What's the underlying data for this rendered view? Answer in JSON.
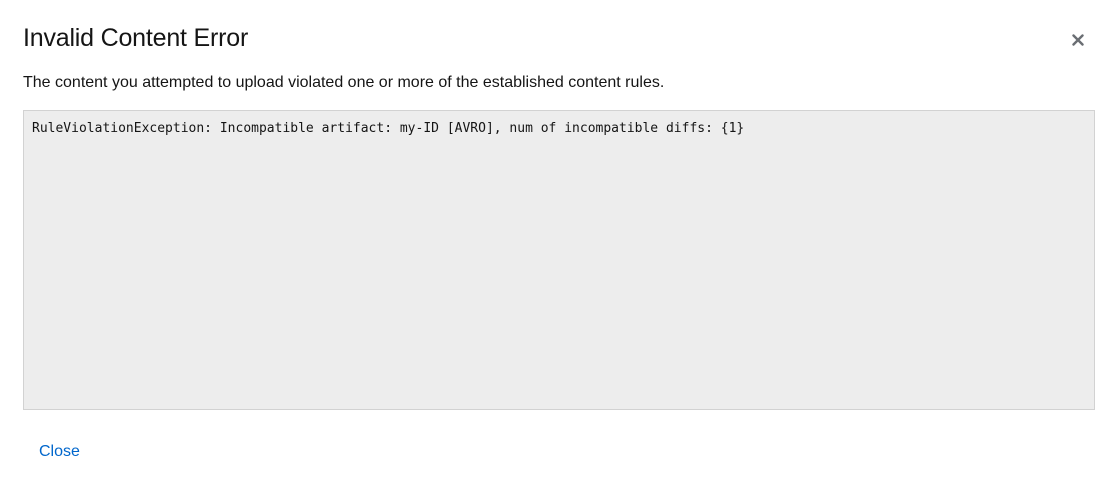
{
  "modal": {
    "title": "Invalid Content Error",
    "description": "The content you attempted to upload violated one or more of the established content rules.",
    "error_message": "RuleViolationException: Incompatible artifact: my-ID [AVRO], num of incompatible diffs: {1}",
    "close_link_label": "Close",
    "close_icon": "close-icon"
  },
  "colors": {
    "link": "#0066cc",
    "error_box_background": "#ededed",
    "text": "#151515"
  }
}
